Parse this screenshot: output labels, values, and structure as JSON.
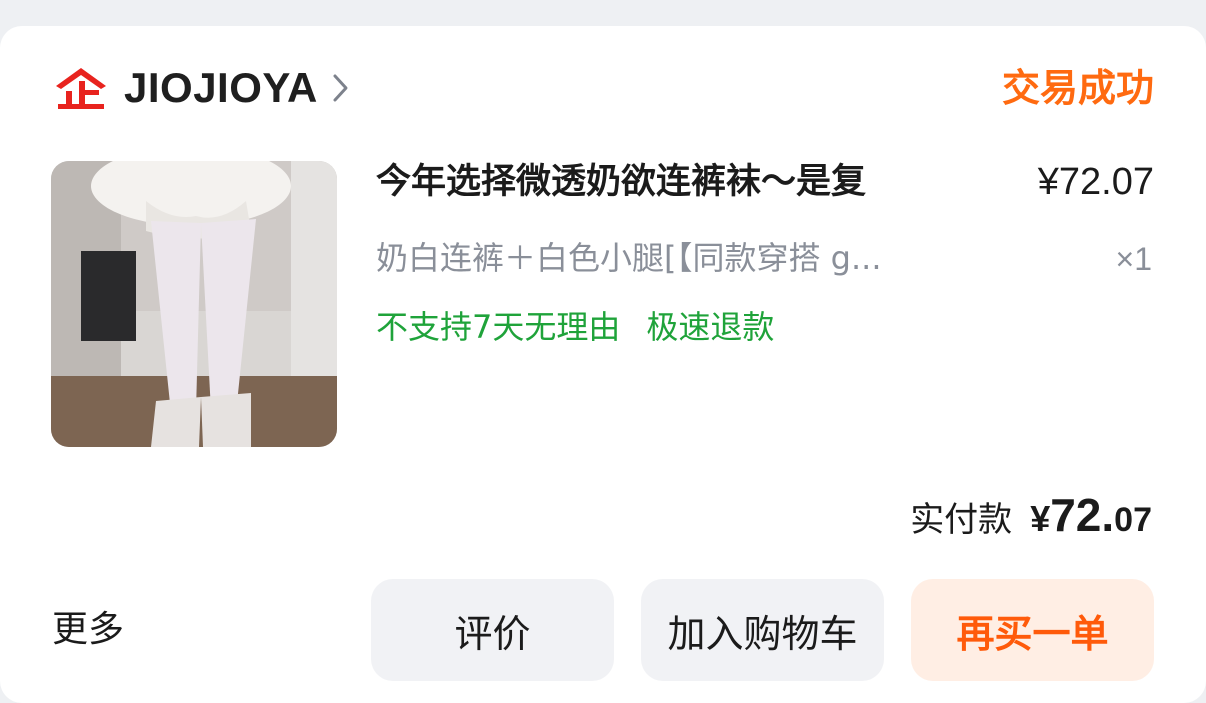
{
  "shop": {
    "name": "JIOJIOYA",
    "logo_icon": "shop-enterprise-logo",
    "chevron_icon": "chevron-right-icon"
  },
  "order": {
    "status": "交易成功",
    "item": {
      "title": "今年选择微透奶欲连裤袜～是复",
      "price": "¥72.07",
      "sku": "奶白连裤＋白色小腿[【同款穿搭 g...",
      "quantity": "×1",
      "tags": [
        "不支持7天无理由",
        "极速退款"
      ]
    },
    "payment": {
      "label": "实付款",
      "currency": "¥",
      "amount_int": "72.",
      "amount_dec": "07"
    }
  },
  "actions": {
    "more": "更多",
    "review": "评价",
    "add_cart": "加入购物车",
    "rebuy": "再买一单"
  },
  "colors": {
    "status": "#ff6a10",
    "logo_red": "#e8231e",
    "tag_green": "#1fa33a",
    "rebuy_bg": "#ffeee4",
    "rebuy_text": "#ff5a0a",
    "button_bg": "#f1f2f5"
  }
}
